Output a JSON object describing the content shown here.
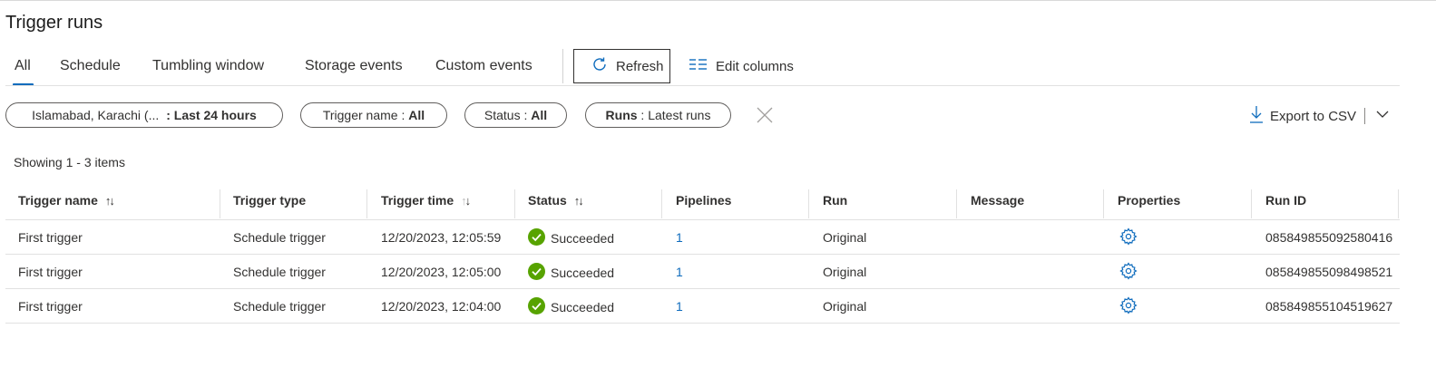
{
  "page": {
    "title": "Trigger runs"
  },
  "tabs": [
    {
      "label": "All",
      "active": true
    },
    {
      "label": "Schedule",
      "active": false
    },
    {
      "label": "Tumbling window",
      "active": false
    },
    {
      "label": "Storage events",
      "active": false
    },
    {
      "label": "Custom events",
      "active": false
    }
  ],
  "toolbar": {
    "refresh_label": "Refresh",
    "edit_columns_label": "Edit columns",
    "export_label": "Export to CSV"
  },
  "filters": {
    "time": {
      "prefix": "Islamabad, Karachi (...",
      "value": ": Last 24 hours"
    },
    "trigger_name": {
      "key": "Trigger name : ",
      "value": "All"
    },
    "status": {
      "key": "Status : ",
      "value": "All"
    },
    "runs": {
      "key": "Runs",
      "value": " : Latest runs"
    }
  },
  "summary": {
    "showing": "Showing 1 - 3 items"
  },
  "table": {
    "columns": [
      "Trigger name",
      "Trigger type",
      "Trigger time",
      "Status",
      "Pipelines",
      "Run",
      "Message",
      "Properties",
      "Run ID"
    ],
    "rows": [
      {
        "trigger_name": "First trigger",
        "trigger_type": "Schedule trigger",
        "trigger_time": "12/20/2023, 12:05:59",
        "status": "Succeeded",
        "pipelines": "1",
        "run": "Original",
        "message": "",
        "run_id": "085849855092580416"
      },
      {
        "trigger_name": "First trigger",
        "trigger_type": "Schedule trigger",
        "trigger_time": "12/20/2023, 12:05:00",
        "status": "Succeeded",
        "pipelines": "1",
        "run": "Original",
        "message": "",
        "run_id": "085849855098498521"
      },
      {
        "trigger_name": "First trigger",
        "trigger_type": "Schedule trigger",
        "trigger_time": "12/20/2023, 12:04:00",
        "status": "Succeeded",
        "pipelines": "1",
        "run": "Original",
        "message": "",
        "run_id": "085849855104519627"
      }
    ]
  },
  "colors": {
    "accent": "#0f6cbd",
    "success": "#57a300",
    "text": "#323130"
  },
  "icons": {
    "refresh": "refresh-icon",
    "edit_columns": "edit-columns-icon",
    "export": "download-icon",
    "clear": "close-icon",
    "chevron": "chevron-down-icon",
    "status": "success-check-icon",
    "properties": "gear-icon",
    "sort": "sort-arrows-icon"
  }
}
